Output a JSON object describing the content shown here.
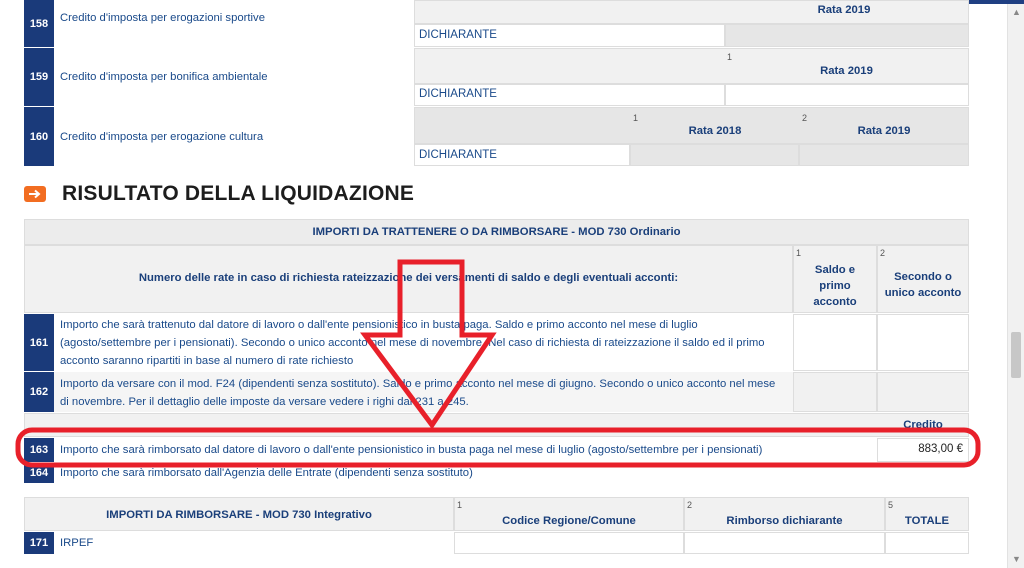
{
  "top_rows": [
    {
      "num": "158",
      "label": "Credito d'imposta per erogazioni sportive",
      "declarant": "DICHIARANTE",
      "rates": [
        {
          "idx": "",
          "label": "Rata 2019"
        }
      ]
    },
    {
      "num": "159",
      "label": "Credito d'imposta per bonifica ambientale",
      "declarant": "DICHIARANTE",
      "rates": [
        {
          "idx": "1",
          "label": "Rata 2019"
        }
      ]
    },
    {
      "num": "160",
      "label": "Credito d'imposta per erogazione cultura",
      "declarant": "DICHIARANTE",
      "rates": [
        {
          "idx": "1",
          "label": "Rata 2018"
        },
        {
          "idx": "2",
          "label": "Rata 2019"
        }
      ]
    }
  ],
  "section": {
    "title": "RISULTATO DELLA LIQUIDAZIONE"
  },
  "liquidazione": {
    "header": "IMPORTI DA TRATTENERE O DA RIMBORSARE - MOD 730 Ordinario",
    "rate_question": "Numero delle rate in caso di richiesta rateizzazione dei versamenti di saldo e degli eventuali acconti:",
    "col1": {
      "idx": "1",
      "l1": "Saldo e",
      "l2": "primo",
      "l3": "acconto"
    },
    "col2": {
      "idx": "2",
      "l1": "Secondo o",
      "l2": "unico acconto"
    },
    "rows": [
      {
        "num": "161",
        "l1": "Importo che sarà trattenuto dal datore di lavoro o dall'ente pensionistico in busta paga. Saldo e primo acconto nel mese di luglio",
        "l2": "(agosto/settembre per i pensionati). Secondo o unico acconto nel mese di novembre. Nel caso di richiesta di rateizzazione il saldo ed il primo",
        "l3": "acconto saranno ripartiti in base al numero di rate richiesto"
      },
      {
        "num": "162",
        "l1": "Importo da versare con il mod. F24 (dipendenti senza sostituto). Saldo e primo acconto nel mese di giugno. Secondo o unico acconto nel mese",
        "l2": "di novembre. Per il dettaglio delle imposte da versare vedere i righi dal 231 a 245."
      }
    ],
    "credito_label": "Credito",
    "row163": {
      "num": "163",
      "label": "Importo che sarà rimborsato dal datore di lavoro o dall'ente pensionistico in busta paga nel mese di luglio (agosto/settembre per i pensionati)",
      "value": "883,00 €"
    },
    "row164": {
      "num": "164",
      "label": "Importo che sarà rimborsato dall'Agenzia delle Entrate (dipendenti senza sostituto)"
    }
  },
  "integrativo": {
    "header": "IMPORTI DA RIMBORSARE - MOD 730 Integrativo",
    "cols": [
      {
        "idx": "1",
        "label": "Codice Regione/Comune"
      },
      {
        "idx": "2",
        "label": "Rimborso dichiarante"
      },
      {
        "idx": "5",
        "label": "TOTALE"
      }
    ],
    "rows": [
      {
        "num": "171",
        "label": "IRPEF"
      }
    ]
  },
  "colors": {
    "nav_blue": "#1a3a7a",
    "text_blue": "#1a4a8a",
    "accent_orange": "#f26d21",
    "annotation_red": "#e8202a"
  }
}
